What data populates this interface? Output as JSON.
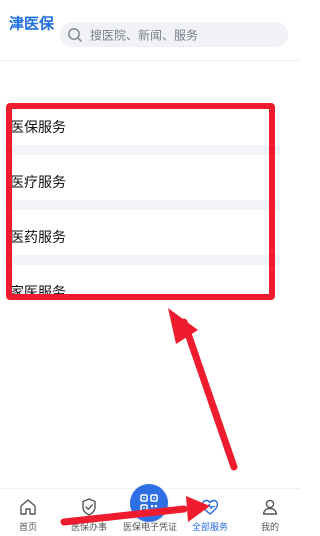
{
  "header": {
    "logo": "津医保",
    "search_placeholder": "搜医院、新闻、服务"
  },
  "menu": [
    {
      "label": "医保服务"
    },
    {
      "label": "医疗服务"
    },
    {
      "label": "医药服务"
    },
    {
      "label": "家医服务"
    }
  ],
  "tabbar": {
    "home": "首页",
    "yibao": "医保办事",
    "voucher": "医保电子凭证",
    "all": "全部服务",
    "mine": "我的"
  },
  "colors": {
    "brand": "#1f6fe0",
    "highlight": "#ee1c2e",
    "active_tab": "#2a6ae0"
  }
}
